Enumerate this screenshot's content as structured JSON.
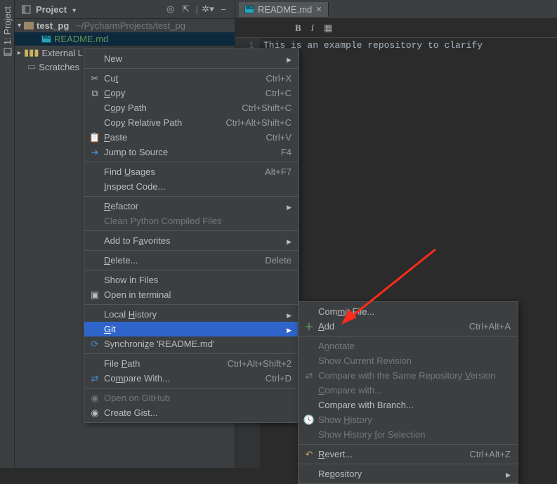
{
  "sidebar_tab": {
    "label": "1: Project"
  },
  "project_panel": {
    "title": "Project"
  },
  "project_tree": {
    "root": "test_pg",
    "root_path": "~/PycharmProjects/test_pg",
    "file": "README.md",
    "external": "External Libraries",
    "scratches": "Scratches and Consoles"
  },
  "editor": {
    "tab_title": "README.md",
    "format_bold": "B",
    "format_italic": "I",
    "line_number": "1",
    "content": "This is an example repository to clarify"
  },
  "ctx_main": {
    "new": "New",
    "cut": "Cut",
    "cut_sc": "Ctrl+X",
    "copy": "Copy",
    "copy_sc": "Ctrl+C",
    "copy_path": "Copy Path",
    "copy_path_sc": "Ctrl+Shift+C",
    "copy_rel": "Copy Relative Path",
    "copy_rel_sc": "Ctrl+Alt+Shift+C",
    "paste": "Paste",
    "paste_sc": "Ctrl+V",
    "jump": "Jump to Source",
    "jump_sc": "F4",
    "find_usages": "Find Usages",
    "find_usages_sc": "Alt+F7",
    "inspect": "Inspect Code...",
    "refactor": "Refactor",
    "clean_py": "Clean Python Compiled Files",
    "favorites": "Add to Favorites",
    "delete": "Delete...",
    "delete_sc": "Delete",
    "show_files": "Show in Files",
    "terminal": "Open in terminal",
    "local_hist": "Local History",
    "git": "Git",
    "sync": "Synchronize 'README.md'",
    "file_path": "File Path",
    "file_path_sc": "Ctrl+Alt+Shift+2",
    "compare": "Compare With...",
    "compare_sc": "Ctrl+D",
    "open_gh": "Open on GitHub",
    "gist": "Create Gist..."
  },
  "ctx_git": {
    "commit": "Commit File...",
    "add": "Add",
    "add_sc": "Ctrl+Alt+A",
    "annotate": "Annotate",
    "show_cur": "Show Current Revision",
    "same_repo": "Compare with the Same Repository Version",
    "compare_with": "Compare with...",
    "compare_branch": "Compare with Branch...",
    "show_hist": "Show History",
    "show_hist_sel": "Show History for Selection",
    "revert": "Revert...",
    "revert_sc": "Ctrl+Alt+Z",
    "repository": "Repository"
  }
}
